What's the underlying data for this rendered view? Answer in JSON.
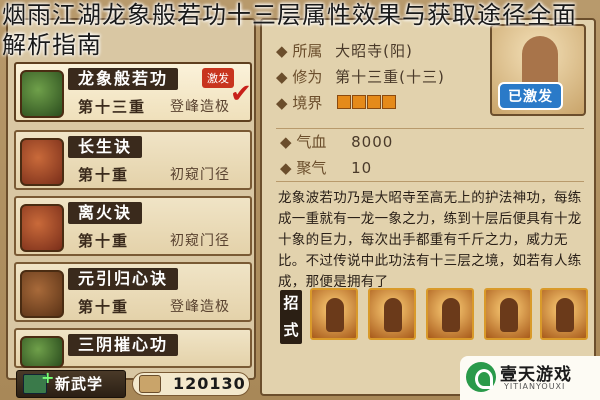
{
  "article_title": {
    "line1": "烟雨江湖龙象般若功十三层属性效果与获取途径全面",
    "line2": "解析指南"
  },
  "skills": [
    {
      "name": "龙象般若功",
      "level": "第十三重",
      "stage": "登峰造极",
      "badge": "激发",
      "icon": "fist-scroll-icon"
    },
    {
      "name": "长生诀",
      "level": "第十重",
      "stage": "初窥门径",
      "icon": "scroll-icon"
    },
    {
      "name": "离火诀",
      "level": "第十重",
      "stage": "初窥门径",
      "icon": "scroll-icon"
    },
    {
      "name": "元引归心诀",
      "level": "第十重",
      "stage": "登峰造极",
      "icon": "pouch-icon"
    },
    {
      "name": "三阴摧心功",
      "icon": "book-icon"
    }
  ],
  "bottom": {
    "new_skill": "新武学",
    "score": "120130"
  },
  "detail": {
    "sect_label": "所属",
    "sect_value": "大昭寺(阳)",
    "cultivation_label": "修为",
    "cultivation_value": "第十三重(十三)",
    "realm_label": "境界",
    "realm_level": 4,
    "activated": "已激发",
    "qixue_label": "气血",
    "qixue_value": "8000",
    "juqi_label": "聚气",
    "juqi_value": "10",
    "description": "龙象波若功乃是大昭寺至高无上的护法神功，每练成一重就有一龙一象之力，练到十层后便具有十龙十象的巨力，每次出手都重有千斤之力，威力无比。不过传说中此功法有十三层之境，如若有人练成，那便是拥有了",
    "moves_label": "招式"
  },
  "watermark": {
    "name": "壹天游戏",
    "url": "YITIANYOUXI"
  }
}
